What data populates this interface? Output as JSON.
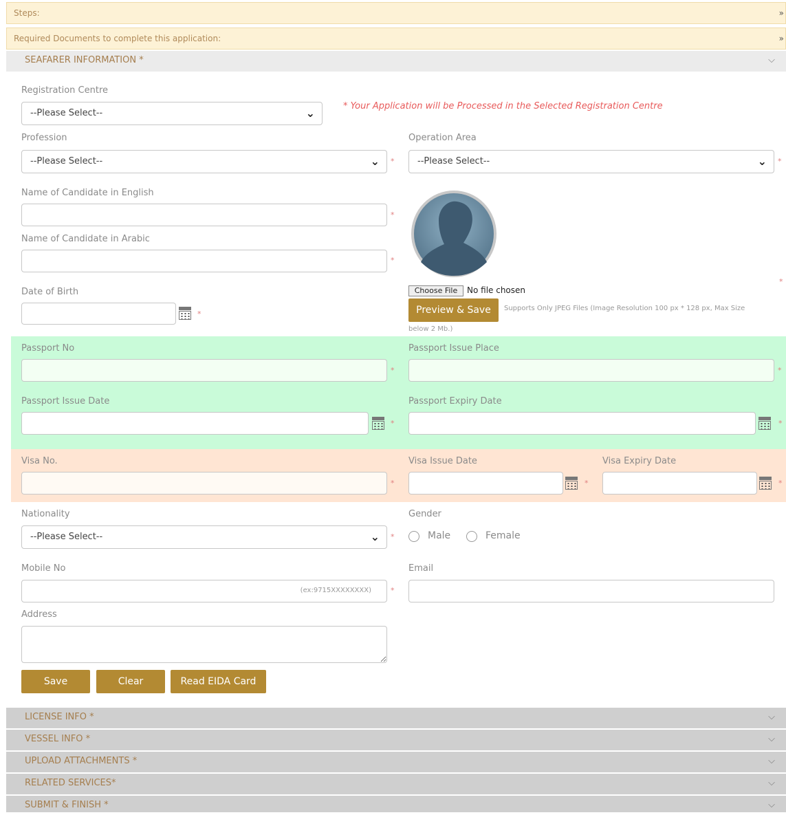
{
  "top_bars": {
    "steps": "Steps:",
    "required_docs": "Required Documents to complete this application:"
  },
  "section": {
    "title": "SEAFARER INFORMATION *"
  },
  "form": {
    "registration_centre_label": "Registration Centre",
    "registration_centre_value": "--Please Select--",
    "registration_notice": "* Your Application will be Processed in the Selected Registration Centre",
    "profession_label": "Profession",
    "profession_value": "--Please Select--",
    "operation_area_label": "Operation Area",
    "operation_area_value": "--Please Select--",
    "name_english_label": "Name of Candidate in English",
    "name_arabic_label": "Name of Candidate in Arabic",
    "dob_label": "Date of Birth",
    "photo_choose_file": "Choose File",
    "photo_no_file": "No file chosen",
    "photo_preview_button": "Preview & Save",
    "photo_hint_1": "Supports Only JPEG Files (Image Resolution 100 px * 128 px, Max Size",
    "photo_hint_2": "below 2 Mb.)",
    "passport_no_label": "Passport No",
    "passport_issue_place_label": "Passport Issue Place",
    "passport_issue_date_label": "Passport Issue Date",
    "passport_expiry_date_label": "Passport Expiry Date",
    "visa_no_label": "Visa No.",
    "visa_issue_date_label": "Visa Issue Date",
    "visa_expiry_date_label": "Visa Expiry Date",
    "nationality_label": "Nationality",
    "nationality_value": "--Please Select--",
    "gender_label": "Gender",
    "gender_male": "Male",
    "gender_female": "Female",
    "mobile_label": "Mobile No",
    "mobile_hint": "(ex:9715XXXXXXXX)",
    "email_label": "Email",
    "address_label": "Address",
    "required_mark": "*"
  },
  "buttons": {
    "save": "Save",
    "clear": "Clear",
    "read_eida": "Read EIDA Card"
  },
  "accordion": [
    {
      "label": "LICENSE INFO *"
    },
    {
      "label": "VESSEL INFO *"
    },
    {
      "label": "UPLOAD ATTACHMENTS *"
    },
    {
      "label": "RELATED SERVICES*"
    },
    {
      "label": "SUBMIT & FINISH *"
    }
  ],
  "icons": {
    "double_chevron": "double-chevron-down-icon",
    "chevron": "chevron-down-icon",
    "calendar": "calendar-icon",
    "avatar": "avatar-silhouette-icon"
  },
  "colors": {
    "gold": "#b38a33",
    "green_zone": "#c9fbd9",
    "peach_zone": "#ffe5d3",
    "required": "#e08080"
  }
}
